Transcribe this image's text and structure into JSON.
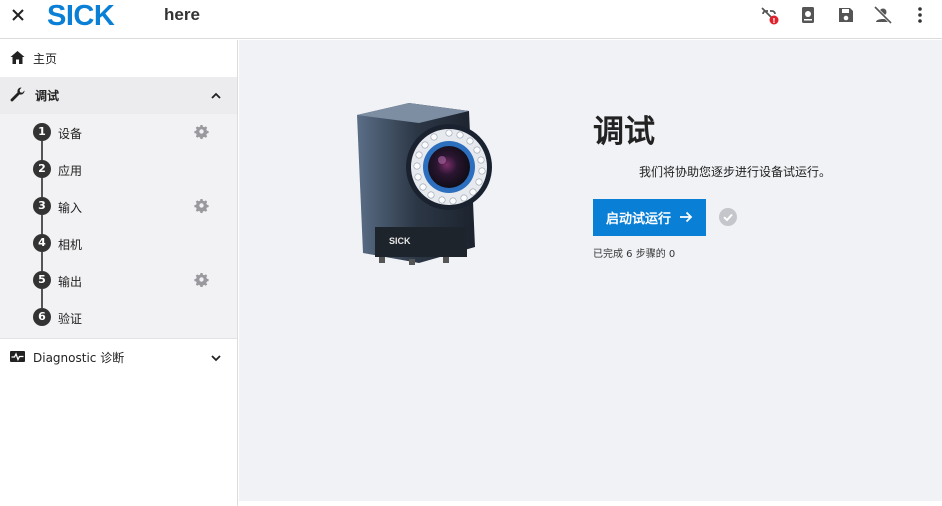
{
  "header": {
    "logo": "SICK",
    "app_title": "here",
    "icons": [
      "close-icon",
      "link-off-alert-icon",
      "device-icon",
      "save-icon",
      "user-off-icon",
      "more-vert-icon"
    ],
    "alert_badge": "!"
  },
  "sidebar": {
    "home_label": "主页",
    "commissioning_label": "调试",
    "steps": [
      {
        "number": "1",
        "label": "设备",
        "has_settings": true
      },
      {
        "number": "2",
        "label": "应用",
        "has_settings": false
      },
      {
        "number": "3",
        "label": "输入",
        "has_settings": true
      },
      {
        "number": "4",
        "label": "相机",
        "has_settings": false
      },
      {
        "number": "5",
        "label": "输出",
        "has_settings": true
      },
      {
        "number": "6",
        "label": "验证",
        "has_settings": false
      }
    ],
    "diagnostic_label": "Diagnostic 诊断"
  },
  "main": {
    "title": "调试",
    "subtitle": "我们将协助您逐步进行设备试运行。",
    "start_button": "启动试运行",
    "progress_text": "已完成 6 步骤的 0",
    "camera_brand": "SICK"
  },
  "colors": {
    "accent": "#0a7fd6",
    "sidebar_selected": "#ececee",
    "steps_bg": "#f2f2f4",
    "main_bg": "#f1f2f5",
    "badge_red": "#e0202a"
  }
}
